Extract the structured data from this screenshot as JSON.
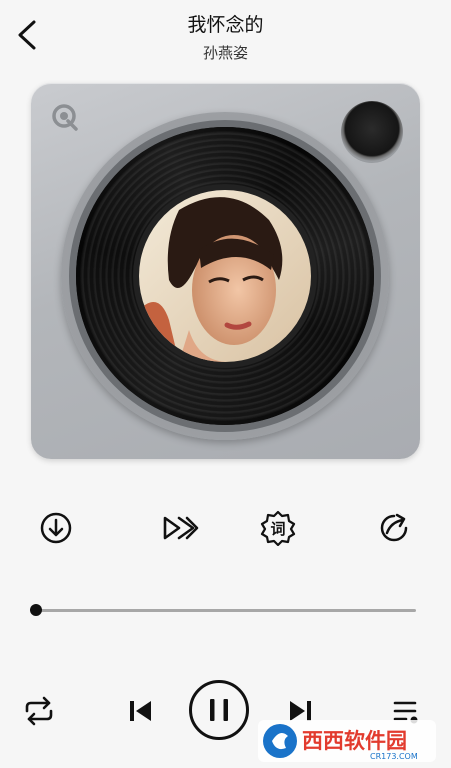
{
  "song": {
    "title": "我怀念的",
    "artist": "孙燕姿"
  },
  "icons": {
    "back": "back-arrow-icon",
    "download": "download-icon",
    "fast_forward": "fast-forward-icon",
    "lyrics": "lyrics-badge-icon",
    "share": "share-icon",
    "repeat": "repeat-icon",
    "previous": "skip-previous-icon",
    "pause": "pause-icon",
    "next": "skip-next-icon",
    "playlist": "playlist-icon"
  },
  "actions": {
    "lyrics_glyph": "词"
  },
  "progress": {
    "fraction": 0.0
  },
  "watermark": {
    "main": "西西软件园",
    "sub": "CR173.COM"
  },
  "colors": {
    "background": "#f6f6f6",
    "card": "#b8bbbf",
    "accent": "#111111",
    "watermark_blue": "#1a73c9",
    "watermark_red": "#e23b2e"
  }
}
